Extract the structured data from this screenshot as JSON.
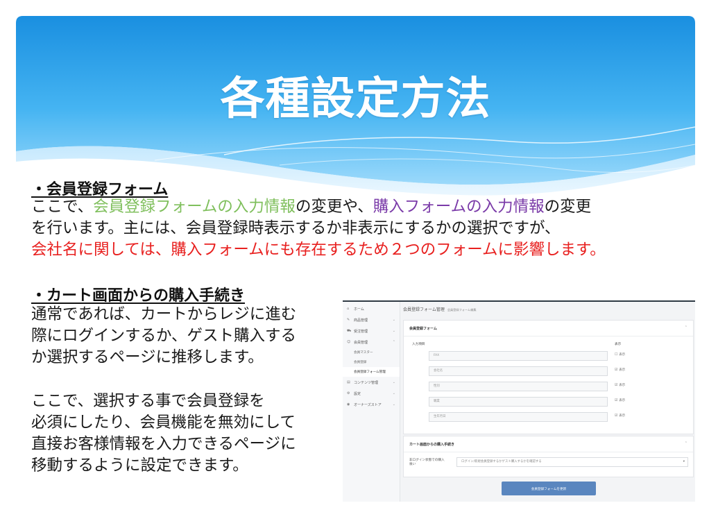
{
  "slide": {
    "title": "各種設定方法"
  },
  "section1": {
    "heading": "・会員登録フォーム",
    "line1": [
      {
        "text": "ここで、",
        "color": "default"
      },
      {
        "text": "会員登録フォームの入力情報",
        "color": "#7fbf5c"
      },
      {
        "text": "の変更や、",
        "color": "default"
      },
      {
        "text": "購入フォームの入力情報",
        "color": "#7a3aa8"
      },
      {
        "text": "の変更",
        "color": "default"
      }
    ],
    "line2": "を行います。主には、会員登録時表示するか非表示にするかの選択ですが、",
    "line3": "会社名に関しては、購入フォームにも存在するため２つのフォームに影響します。"
  },
  "section2": {
    "heading": "・カート画面からの購入手続き",
    "para1": [
      "通常であれば、カートからレジに進む",
      "際にログインするか、ゲスト購入する",
      "か選択するページに推移します。"
    ],
    "para2": [
      "ここで、選択する事で会員登録を",
      "必須にしたり、会員機能を無効にして",
      "直接お客様情報を入力できるページに",
      "移動するように設定できます。"
    ]
  },
  "screenshot": {
    "sidebar": {
      "items": [
        {
          "icon": "home-icon",
          "glyph": "⌂",
          "label": "ホーム",
          "chevron": false
        },
        {
          "icon": "tag-icon",
          "glyph": "✎",
          "label": "商品管理",
          "chevron": true
        },
        {
          "icon": "cart-icon",
          "glyph": "⛟",
          "label": "受注管理",
          "chevron": true
        },
        {
          "icon": "users-icon",
          "glyph": "☺",
          "label": "会員管理",
          "chevron": true
        }
      ],
      "subitems": [
        {
          "label": "会員マスター",
          "active": false
        },
        {
          "label": "会員登録",
          "active": false
        },
        {
          "label": "会員登録フォーム管理",
          "active": true
        }
      ],
      "items2": [
        {
          "icon": "document-icon",
          "glyph": "▤",
          "label": "コンテンツ管理",
          "chevron": true
        },
        {
          "icon": "gear-icon",
          "glyph": "⚙",
          "label": "設定",
          "chevron": true
        },
        {
          "icon": "store-icon",
          "glyph": "◉",
          "label": "オーナーズストア",
          "chevron": true
        }
      ]
    },
    "page_title": "会員登録フォーム管理",
    "page_subtitle": "会員登録フォーム編集",
    "card1": {
      "title": "会員登録フォーム",
      "col_input": "入力項目",
      "col_display": "表示",
      "rows": [
        {
          "placeholder": "FAX",
          "checked": false,
          "check_label": "表示"
        },
        {
          "placeholder": "会社名",
          "checked": true,
          "check_label": "表示"
        },
        {
          "placeholder": "性別",
          "checked": true,
          "check_label": "表示"
        },
        {
          "placeholder": "職業",
          "checked": true,
          "check_label": "表示"
        },
        {
          "placeholder": "生年月日",
          "checked": true,
          "check_label": "表示"
        }
      ]
    },
    "card2": {
      "title": "カート画面からの購入手続き",
      "row_label": "非ログイン状態での購入後い",
      "select_value": "ログイン/新規会員登録するかゲスト購入するかを確認する"
    },
    "submit_label": "会員登録フォームを更新"
  }
}
